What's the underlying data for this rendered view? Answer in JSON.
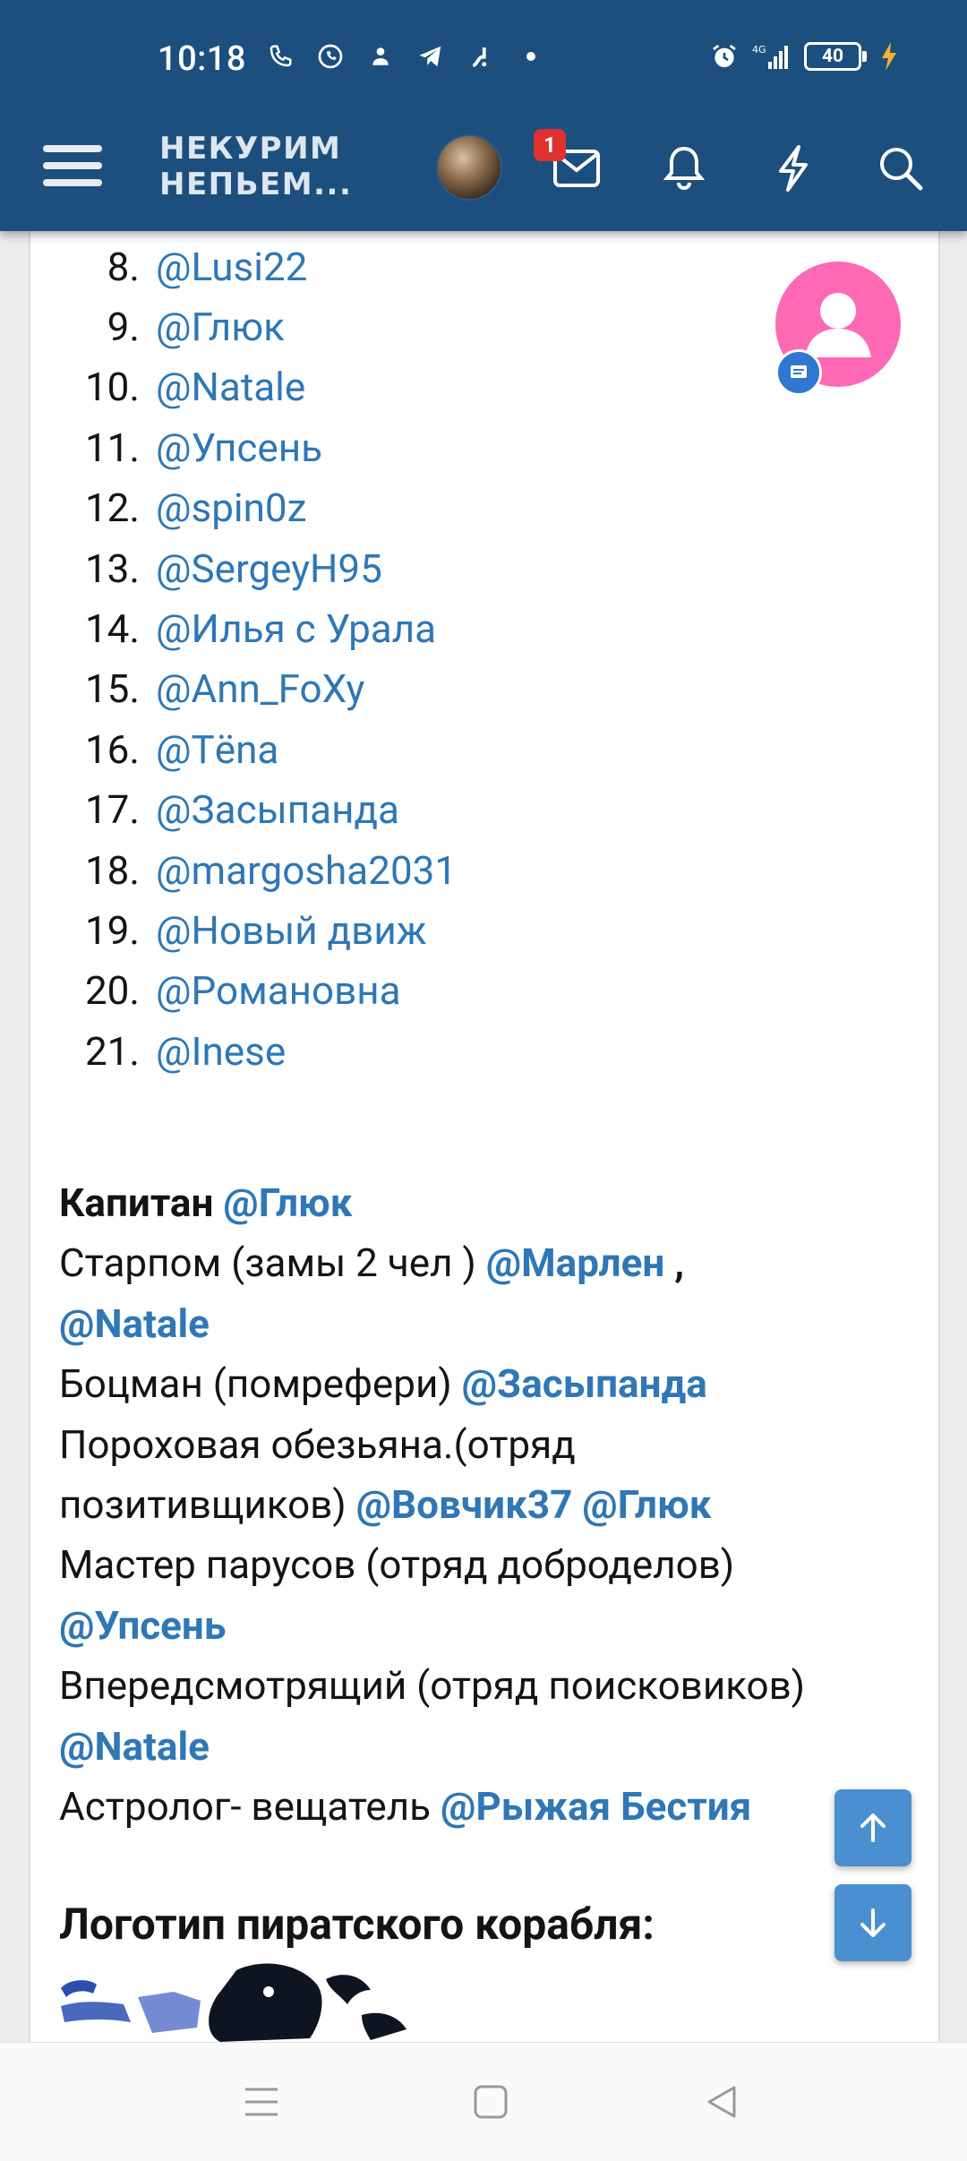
{
  "status_bar": {
    "time": "10:18",
    "battery": "40",
    "network": "4G"
  },
  "header": {
    "brand_line1": "НЕКУРИМ",
    "brand_line2": "НЕПЬЕМ...",
    "notification_badge": "1",
    "icons": [
      "menu-icon",
      "avatar",
      "mail-icon",
      "bell-icon",
      "lightning-icon",
      "search-icon"
    ],
    "colors": {
      "bar": "#1d4f7e",
      "badge": "#e03131"
    }
  },
  "list": {
    "items": [
      {
        "num": "8.",
        "name": "@Lusi22"
      },
      {
        "num": "9.",
        "name": "@Глюк"
      },
      {
        "num": "10.",
        "name": "@Natale"
      },
      {
        "num": "11.",
        "name": "@Упсень"
      },
      {
        "num": "12.",
        "name": "@spin0z"
      },
      {
        "num": "13.",
        "name": "@SergeyH95"
      },
      {
        "num": "14.",
        "name": "@Илья с Урала"
      },
      {
        "num": "15.",
        "name": "@Ann_FoXy"
      },
      {
        "num": "16.",
        "name": "@Tёna"
      },
      {
        "num": "17.",
        "name": "@Засыпанда"
      },
      {
        "num": "18.",
        "name": "@margosha2031"
      },
      {
        "num": "19.",
        "name": "@Новый движ"
      },
      {
        "num": "20.",
        "name": "@Романовна"
      },
      {
        "num": "21.",
        "name": "@Inese"
      }
    ]
  },
  "roles": {
    "captain_label": "Капитан",
    "captain_mention": "@Глюк",
    "starpom_label": "Старпом (замы 2 чел )",
    "starpom_mention1": "@Марлен",
    "starpom_sep": " ,",
    "starpom_mention2": "@Natale",
    "botsman_label": "Боцман (помрефери)",
    "botsman_mention": "@Засыпанда",
    "monkey_label1": "Пороховая обезьяна.(отряд",
    "monkey_label2": "позитивщиков)",
    "monkey_mention1": "@Вовчик37",
    "monkey_mention2": "@Глюк",
    "sails_label": "Мастер парусов (отряд доброделов)",
    "sails_mention": "@Упсень",
    "lookout_label": "Впередсмотрящий (отряд поисковиков)",
    "lookout_mention": "@Natale",
    "astro_label": "Астролог- вещатель",
    "astro_mention": "@Рыжая Бестия"
  },
  "logo_section": {
    "title": "Логотип пиратского корабля:"
  },
  "floating": {
    "user_fab_color": "#ff69b4",
    "scroll_up_icon": "arrow-up-icon",
    "scroll_down_icon": "arrow-down-icon"
  },
  "nav_bar": {
    "icons": [
      "recent-apps-icon",
      "home-icon",
      "back-icon"
    ]
  }
}
